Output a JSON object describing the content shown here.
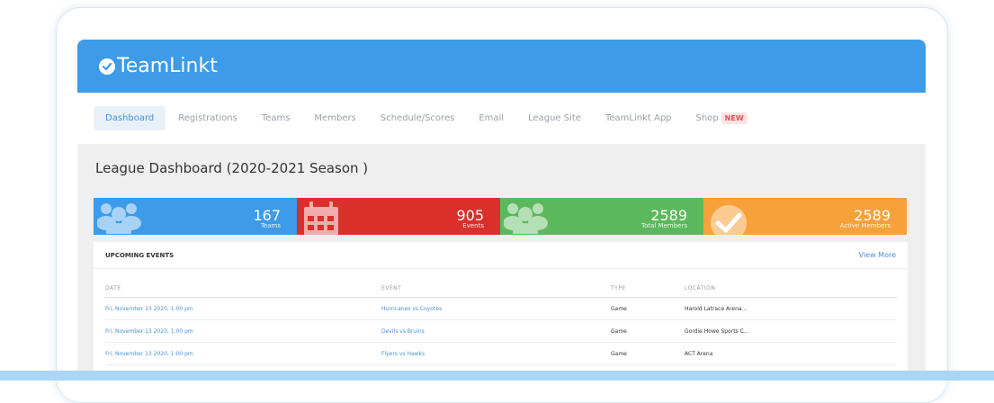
{
  "app": {
    "logo_text": "TeamLinkt"
  },
  "nav": {
    "items": [
      {
        "label": "Dashboard",
        "active": true
      },
      {
        "label": "Registrations"
      },
      {
        "label": "Teams"
      },
      {
        "label": "Members"
      },
      {
        "label": "Schedule/Scores"
      },
      {
        "label": "Email"
      },
      {
        "label": "League Site"
      },
      {
        "label": "TeamLinkt App"
      },
      {
        "label": "Shop",
        "badge": "NEW"
      }
    ]
  },
  "page": {
    "title": "League Dashboard (2020-2021 Season )"
  },
  "stats": [
    {
      "value": "167",
      "label": "Teams",
      "color": "#3d9be9",
      "icon": "users-icon"
    },
    {
      "value": "905",
      "label": "Events",
      "color": "#d9302c",
      "icon": "calendar-icon"
    },
    {
      "value": "2589",
      "label": "Total Members",
      "color": "#5cb85c",
      "icon": "users-icon"
    },
    {
      "value": "2589",
      "label": "Active Members",
      "color": "#f7a13a",
      "icon": "check-icon"
    }
  ],
  "events": {
    "title": "UPCOMING EVENTS",
    "view_more": "View More",
    "columns": [
      "DATE",
      "EVENT",
      "TYPE",
      "LOCATION"
    ],
    "rows": [
      {
        "date": "Fri, November 13 2020, 1:00 pm",
        "event": "Hurricanes vs Coyotes",
        "type": "Game",
        "location": "Harold Latrace Arena..."
      },
      {
        "date": "Fri, November 13 2020, 1:00 pm",
        "event": "Devils vs Bruins",
        "type": "Game",
        "location": "Gordie Howe Sports C..."
      },
      {
        "date": "Fri, November 13 2020, 1:00 pm",
        "event": "Flyers vs Hawks",
        "type": "Game",
        "location": "ACT Arena"
      }
    ]
  }
}
